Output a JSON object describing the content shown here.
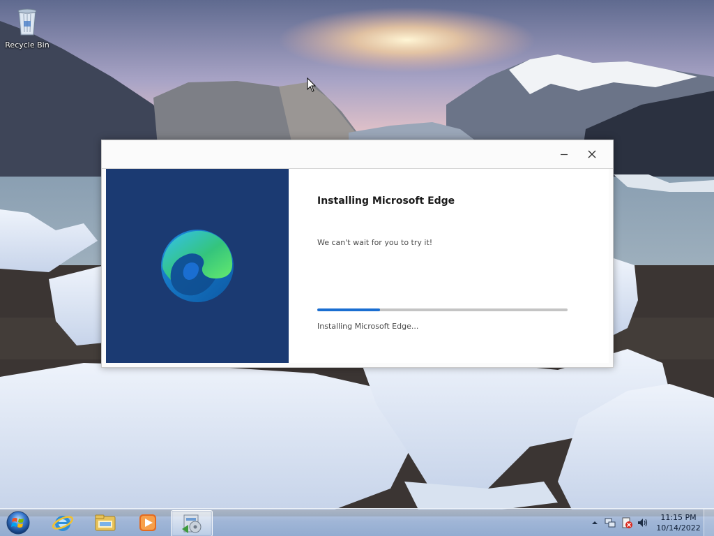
{
  "desktop": {
    "icons": [
      {
        "label": "Recycle Bin",
        "icon": "recycle-bin-icon"
      }
    ]
  },
  "installer": {
    "heading": "Installing Microsoft Edge",
    "subtitle": "We can't wait for you to try it!",
    "status": "Installing Microsoft Edge...",
    "progress_fraction": 0.25,
    "caption_buttons": [
      "minimize-icon",
      "close-icon"
    ],
    "logo": "edge-logo-icon",
    "colors": {
      "left_panel": "#1b3a72",
      "progress_fill": "#1a6ed1",
      "progress_track": "#c4c4c4"
    }
  },
  "taskbar": {
    "start_icon": "windows-start-orb-icon",
    "pinned": [
      {
        "name": "Internet Explorer",
        "icon": "internet-explorer-icon"
      },
      {
        "name": "Windows Explorer",
        "icon": "folder-icon"
      },
      {
        "name": "Windows Media Player",
        "icon": "media-player-icon"
      },
      {
        "name": "Microsoft Edge Setup",
        "icon": "setup-installer-icon",
        "active": true
      }
    ],
    "tray": {
      "icons": [
        "show-hidden-icons-arrow-icon",
        "network-icon",
        "action-center-icon",
        "volume-icon"
      ],
      "time": "11:15 PM",
      "date": "10/14/2022"
    }
  }
}
